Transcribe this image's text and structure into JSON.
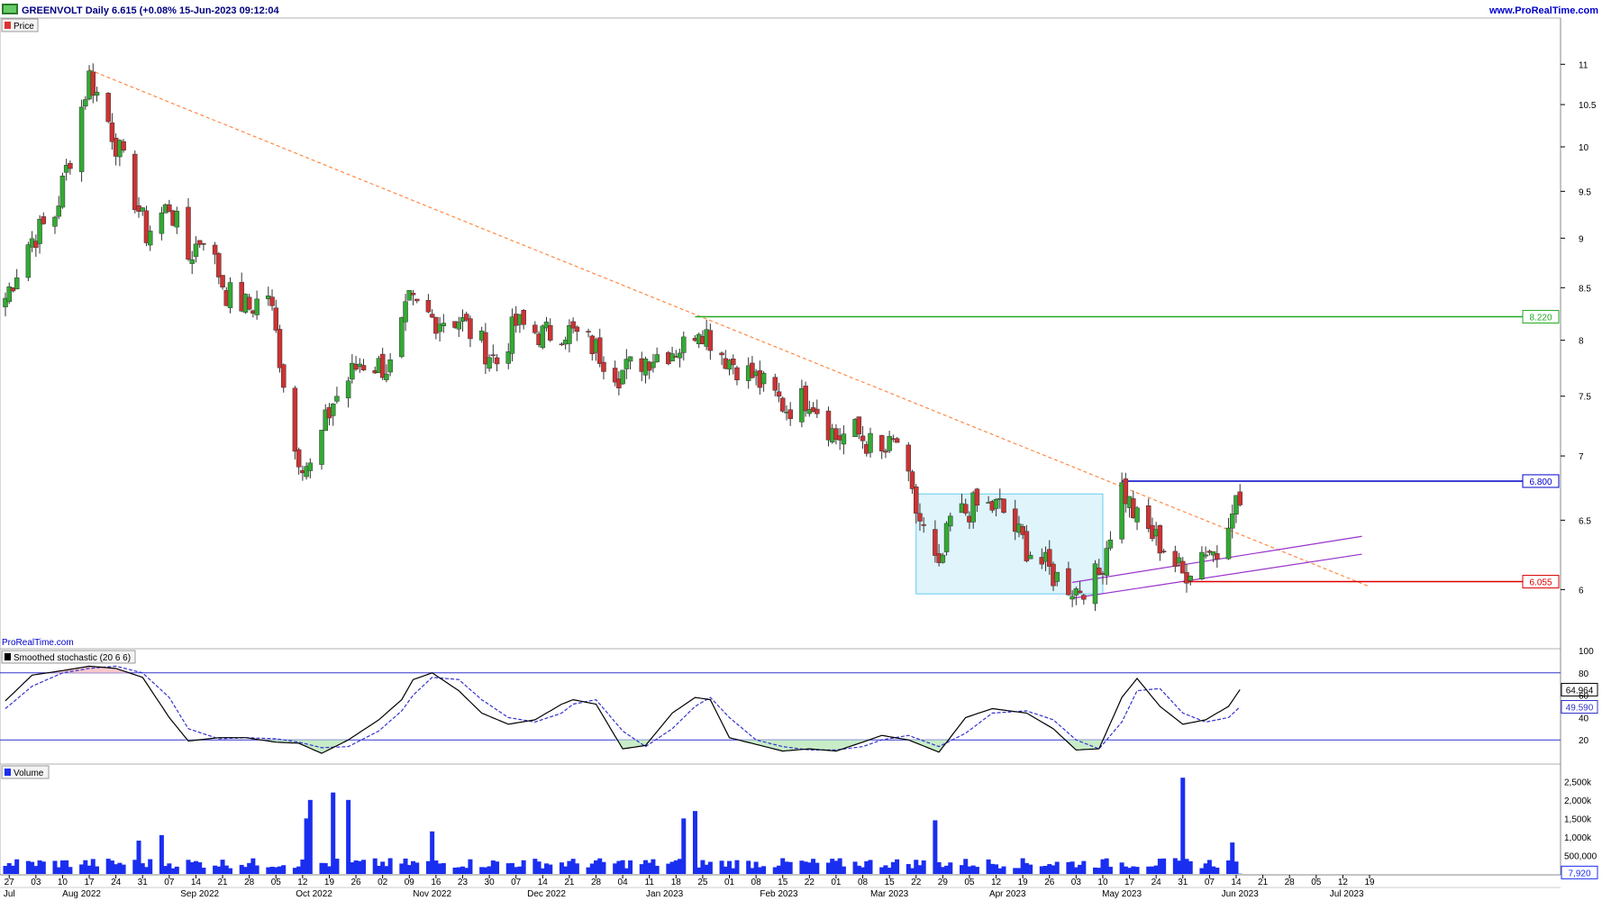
{
  "header": {
    "title": "GREENVOLT Daily 6.615 (+0.08% 15-Jun-2023 09:12:04",
    "site": "www.ProRealTime.com",
    "watermark": "ProRealTime.com"
  },
  "panes": {
    "price_label": "Price",
    "stoch_label": "Smoothed stochastic (20 6 6)",
    "volume_label": "Volume"
  },
  "colors": {
    "up": "#33aa33",
    "down": "#cc3333",
    "trendline": "#ff8844",
    "resistance": "#22aa22",
    "support_blue": "#0000cc",
    "support_red": "#dd0000",
    "channel": "#9933cc",
    "box_fill": "#dff4fb",
    "box_stroke": "#66ccee",
    "volume": "#1a2ef0",
    "stoch_k": "#000000",
    "stoch_d": "#3333cc",
    "stoch_level": "#3333cc"
  },
  "chart_data": [
    {
      "type": "candlestick",
      "title": "GREENVOLT Daily",
      "ylim": [
        5.94,
        11.2
      ],
      "y_scale": "log",
      "y_ticks": [
        6,
        6.5,
        7,
        7.5,
        8,
        8.5,
        9,
        9.5,
        10,
        10.5,
        11
      ],
      "x_start": "2022-07-26",
      "x_end": "2023-07-19",
      "month_labels": [
        {
          "date": "2022-07-27",
          "text": "Jul"
        },
        {
          "date": "2022-08-15",
          "text": "Aug 2022"
        },
        {
          "date": "2022-09-15",
          "text": "Sep 2022"
        },
        {
          "date": "2022-10-15",
          "text": "Oct 2022"
        },
        {
          "date": "2022-11-15",
          "text": "Nov 2022"
        },
        {
          "date": "2022-12-15",
          "text": "Dec 2022"
        },
        {
          "date": "2023-01-15",
          "text": "Jan 2023"
        },
        {
          "date": "2023-02-14",
          "text": "Feb 2023"
        },
        {
          "date": "2023-03-15",
          "text": "Mar 2023"
        },
        {
          "date": "2023-04-15",
          "text": "Apr 2023"
        },
        {
          "date": "2023-05-15",
          "text": "May 2023"
        },
        {
          "date": "2023-06-15",
          "text": "Jun 2023"
        },
        {
          "date": "2023-07-13",
          "text": "Jul 2023"
        }
      ],
      "price_tags": [
        {
          "value": 8.22,
          "text": "8.220",
          "color": "#22aa22"
        },
        {
          "value": 6.8,
          "text": "6.800",
          "color": "#0000cc"
        },
        {
          "value": 6.055,
          "text": "6.055",
          "color": "#dd0000"
        }
      ],
      "levels": [
        {
          "from": "2023-01-23",
          "value": 8.22,
          "color": "#22aa22"
        },
        {
          "from": "2023-05-15",
          "value": 6.8,
          "color": "#0000cc"
        },
        {
          "from": "2023-05-31",
          "value": 6.055,
          "color": "#dd0000"
        }
      ],
      "trendline": {
        "from": [
          "2022-08-17",
          10.93
        ],
        "to": [
          "2023-07-19",
          6.02
        ]
      },
      "channel": [
        {
          "from": [
            "2023-05-02",
            5.94
          ],
          "to": [
            "2023-07-17",
            6.25
          ]
        },
        {
          "from": [
            "2023-05-02",
            6.05
          ],
          "to": [
            "2023-07-17",
            6.38
          ]
        }
      ],
      "box": {
        "from": "2023-03-22",
        "to": "2023-05-10",
        "top": 6.7,
        "bottom": 5.97
      },
      "pivots": [
        [
          "2022-07-26",
          8.4
        ],
        [
          "2022-08-01",
          8.95
        ],
        [
          "2022-08-08",
          9.25
        ],
        [
          "2022-08-12",
          9.9
        ],
        [
          "2022-08-17",
          10.85
        ],
        [
          "2022-08-22",
          10.3
        ],
        [
          "2022-08-26",
          9.8
        ],
        [
          "2022-09-01",
          9.05
        ],
        [
          "2022-09-07",
          9.35
        ],
        [
          "2022-09-12",
          8.8
        ],
        [
          "2022-09-16",
          9.05
        ],
        [
          "2022-09-22",
          8.45
        ],
        [
          "2022-09-28",
          8.3
        ],
        [
          "2022-10-03",
          8.45
        ],
        [
          "2022-10-10",
          7.05
        ],
        [
          "2022-10-14",
          6.9
        ],
        [
          "2022-10-20",
          7.45
        ],
        [
          "2022-10-27",
          7.8
        ],
        [
          "2022-11-04",
          7.75
        ],
        [
          "2022-11-09",
          8.35
        ],
        [
          "2022-11-15",
          8.2
        ],
        [
          "2022-11-22",
          8.2
        ],
        [
          "2022-12-02",
          7.8
        ],
        [
          "2022-12-07",
          8.15
        ],
        [
          "2022-12-14",
          8.05
        ],
        [
          "2022-12-20",
          8.1
        ],
        [
          "2022-12-27",
          7.95
        ],
        [
          "2023-01-03",
          7.7
        ],
        [
          "2023-01-11",
          7.85
        ],
        [
          "2023-01-20",
          7.95
        ],
        [
          "2023-01-24",
          8.15
        ],
        [
          "2023-01-31",
          7.85
        ],
        [
          "2023-02-08",
          7.65
        ],
        [
          "2023-02-16",
          7.4
        ],
        [
          "2023-02-22",
          7.5
        ],
        [
          "2023-03-01",
          7.15
        ],
        [
          "2023-03-06",
          7.2
        ],
        [
          "2023-03-13",
          7.0
        ],
        [
          "2023-03-17",
          7.12
        ],
        [
          "2023-03-21",
          6.65
        ],
        [
          "2023-03-28",
          6.1
        ],
        [
          "2023-03-31",
          6.5
        ],
        [
          "2023-04-06",
          6.6
        ],
        [
          "2023-04-13",
          6.6
        ],
        [
          "2023-04-20",
          6.3
        ],
        [
          "2023-04-27",
          6.1
        ],
        [
          "2023-05-03",
          6.0
        ],
        [
          "2023-05-09",
          6.1
        ],
        [
          "2023-05-15",
          6.75
        ],
        [
          "2023-05-19",
          6.5
        ],
        [
          "2023-05-26",
          6.3
        ],
        [
          "2023-05-31",
          6.1
        ],
        [
          "2023-06-06",
          6.3
        ],
        [
          "2023-06-09",
          6.25
        ],
        [
          "2023-06-13",
          6.65
        ],
        [
          "2023-06-15",
          6.615
        ]
      ]
    },
    {
      "type": "line",
      "title": "Smoothed stochastic (20 6 6)",
      "ylim": [
        0,
        100
      ],
      "y_ticks": [
        20,
        40,
        60,
        80,
        100
      ],
      "levels": [
        20,
        80
      ],
      "last_values": [
        {
          "value": 64.964,
          "text": "64.964"
        },
        {
          "value": 49.59,
          "text": "49.590"
        }
      ],
      "series": [
        {
          "key": "k",
          "points": [
            [
              "2022-07-26",
              55
            ],
            [
              "2022-08-02",
              78
            ],
            [
              "2022-08-10",
              82
            ],
            [
              "2022-08-17",
              86
            ],
            [
              "2022-08-24",
              84
            ],
            [
              "2022-08-31",
              76
            ],
            [
              "2022-09-07",
              40
            ],
            [
              "2022-09-12",
              19
            ],
            [
              "2022-09-20",
              22
            ],
            [
              "2022-09-27",
              22
            ],
            [
              "2022-10-05",
              18
            ],
            [
              "2022-10-11",
              17
            ],
            [
              "2022-10-17",
              8
            ],
            [
              "2022-10-24",
              20
            ],
            [
              "2022-11-01",
              38
            ],
            [
              "2022-11-07",
              56
            ],
            [
              "2022-11-10",
              74
            ],
            [
              "2022-11-15",
              80
            ],
            [
              "2022-11-22",
              64
            ],
            [
              "2022-11-28",
              44
            ],
            [
              "2022-12-05",
              34
            ],
            [
              "2022-12-12",
              38
            ],
            [
              "2022-12-19",
              52
            ],
            [
              "2022-12-22",
              56
            ],
            [
              "2022-12-28",
              52
            ],
            [
              "2023-01-04",
              12
            ],
            [
              "2023-01-10",
              15
            ],
            [
              "2023-01-17",
              44
            ],
            [
              "2023-01-23",
              58
            ],
            [
              "2023-01-27",
              56
            ],
            [
              "2023-02-01",
              22
            ],
            [
              "2023-02-08",
              16
            ],
            [
              "2023-02-15",
              10
            ],
            [
              "2023-02-22",
              12
            ],
            [
              "2023-03-01",
              10
            ],
            [
              "2023-03-08",
              18
            ],
            [
              "2023-03-13",
              24
            ],
            [
              "2023-03-20",
              20
            ],
            [
              "2023-03-28",
              9
            ],
            [
              "2023-04-04",
              40
            ],
            [
              "2023-04-11",
              48
            ],
            [
              "2023-04-20",
              44
            ],
            [
              "2023-04-27",
              30
            ],
            [
              "2023-05-03",
              11
            ],
            [
              "2023-05-09",
              12
            ],
            [
              "2023-05-15",
              58
            ],
            [
              "2023-05-19",
              75
            ],
            [
              "2023-05-25",
              50
            ],
            [
              "2023-05-31",
              34
            ],
            [
              "2023-06-06",
              38
            ],
            [
              "2023-06-12",
              50
            ],
            [
              "2023-06-15",
              65
            ]
          ]
        },
        {
          "key": "d",
          "points": [
            [
              "2022-07-26",
              48
            ],
            [
              "2022-08-02",
              68
            ],
            [
              "2022-08-10",
              80
            ],
            [
              "2022-08-17",
              84
            ],
            [
              "2022-08-24",
              86
            ],
            [
              "2022-08-31",
              80
            ],
            [
              "2022-09-07",
              58
            ],
            [
              "2022-09-12",
              30
            ],
            [
              "2022-09-20",
              21
            ],
            [
              "2022-09-27",
              22
            ],
            [
              "2022-10-05",
              21
            ],
            [
              "2022-10-11",
              18
            ],
            [
              "2022-10-17",
              13
            ],
            [
              "2022-10-24",
              14
            ],
            [
              "2022-11-01",
              28
            ],
            [
              "2022-11-07",
              46
            ],
            [
              "2022-11-10",
              60
            ],
            [
              "2022-11-15",
              76
            ],
            [
              "2022-11-22",
              74
            ],
            [
              "2022-11-28",
              56
            ],
            [
              "2022-12-05",
              40
            ],
            [
              "2022-12-12",
              36
            ],
            [
              "2022-12-19",
              44
            ],
            [
              "2022-12-22",
              52
            ],
            [
              "2022-12-28",
              56
            ],
            [
              "2023-01-04",
              28
            ],
            [
              "2023-01-10",
              14
            ],
            [
              "2023-01-17",
              30
            ],
            [
              "2023-01-23",
              50
            ],
            [
              "2023-01-27",
              58
            ],
            [
              "2023-02-01",
              40
            ],
            [
              "2023-02-08",
              20
            ],
            [
              "2023-02-15",
              14
            ],
            [
              "2023-02-22",
              11
            ],
            [
              "2023-03-01",
              11
            ],
            [
              "2023-03-08",
              14
            ],
            [
              "2023-03-13",
              20
            ],
            [
              "2023-03-20",
              24
            ],
            [
              "2023-03-28",
              14
            ],
            [
              "2023-04-04",
              26
            ],
            [
              "2023-04-11",
              44
            ],
            [
              "2023-04-20",
              46
            ],
            [
              "2023-04-27",
              38
            ],
            [
              "2023-05-03",
              20
            ],
            [
              "2023-05-09",
              12
            ],
            [
              "2023-05-15",
              36
            ],
            [
              "2023-05-19",
              64
            ],
            [
              "2023-05-25",
              66
            ],
            [
              "2023-05-31",
              44
            ],
            [
              "2023-06-06",
              36
            ],
            [
              "2023-06-12",
              40
            ],
            [
              "2023-06-15",
              49.59
            ]
          ]
        }
      ]
    },
    {
      "type": "bar",
      "title": "Volume",
      "ylim": [
        0,
        2750000
      ],
      "y_ticks": [
        {
          "value": 500000,
          "text": "500,000"
        },
        {
          "value": 1000000,
          "text": "1,000k"
        },
        {
          "value": 1500000,
          "text": "1,500k"
        },
        {
          "value": 2000000,
          "text": "2,000k"
        },
        {
          "value": 2500000,
          "text": "2,500k"
        }
      ],
      "last_value": {
        "value": 7920,
        "text": "7,920"
      },
      "spikes": [
        [
          "2022-08-30",
          900000
        ],
        [
          "2022-09-05",
          1050000
        ],
        [
          "2022-10-13",
          1500000
        ],
        [
          "2022-10-14",
          2000000
        ],
        [
          "2022-10-20",
          2200000
        ],
        [
          "2022-10-24",
          2000000
        ],
        [
          "2022-11-15",
          1150000
        ],
        [
          "2023-01-20",
          1500000
        ],
        [
          "2023-01-23",
          1700000
        ],
        [
          "2023-03-27",
          1450000
        ],
        [
          "2023-05-31",
          2600000
        ],
        [
          "2023-06-13",
          850000
        ]
      ]
    }
  ]
}
